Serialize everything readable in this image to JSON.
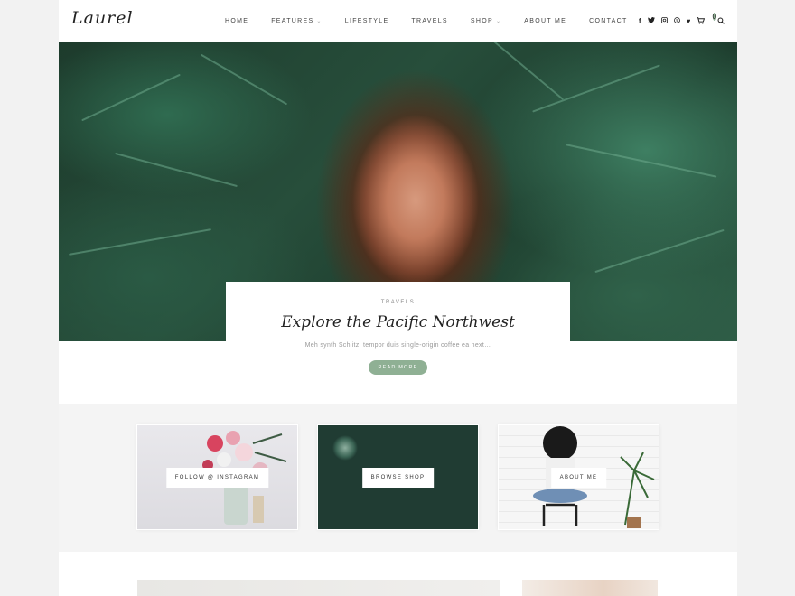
{
  "header": {
    "logo": "Laurel",
    "nav": [
      {
        "label": "HOME",
        "has_dropdown": false
      },
      {
        "label": "FEATURES",
        "has_dropdown": true
      },
      {
        "label": "LIFESTYLE",
        "has_dropdown": false
      },
      {
        "label": "TRAVELS",
        "has_dropdown": false
      },
      {
        "label": "SHOP",
        "has_dropdown": true
      },
      {
        "label": "ABOUT ME",
        "has_dropdown": false
      },
      {
        "label": "CONTACT",
        "has_dropdown": false
      }
    ],
    "social_icons": [
      "facebook-icon",
      "twitter-icon",
      "instagram-icon",
      "pinterest-icon",
      "heart-icon",
      "cart-icon",
      "search-icon"
    ],
    "cart_count": "0"
  },
  "hero": {
    "category": "TRAVELS",
    "title": "Explore the Pacific Northwest",
    "excerpt": "Meh synth Schlitz, tempor duis single-origin coffee ea next…",
    "button_label": "READ MORE"
  },
  "promo": [
    {
      "label": "FOLLOW @ INSTAGRAM"
    },
    {
      "label": "BROWSE SHOP"
    },
    {
      "label": "ABOUT ME"
    }
  ],
  "colors": {
    "accent": "#8fb094",
    "background": "#f2f2f2",
    "text": "#222222"
  }
}
